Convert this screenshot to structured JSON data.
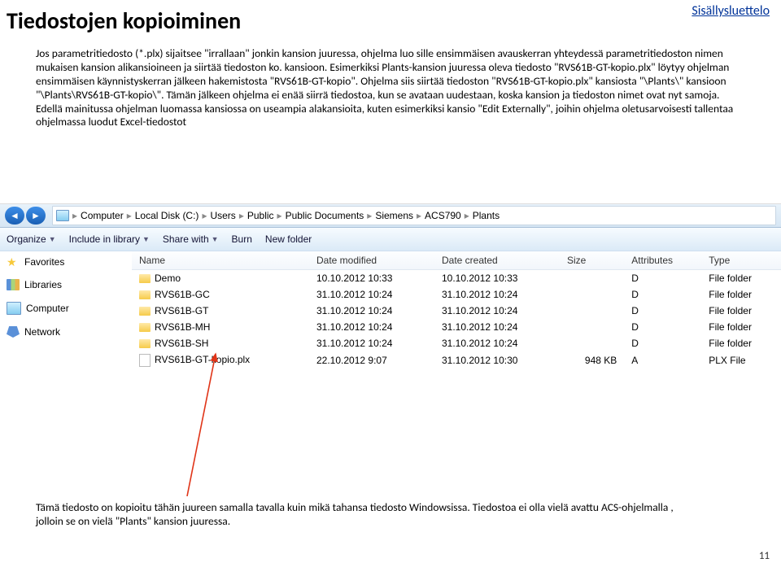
{
  "title": "Tiedostojen kopioiminen",
  "toc_link": "Sisällysluettelo",
  "body": "Jos parametritiedosto (*.plx) sijaitsee \"irrallaan\" jonkin kansion juuressa, ohjelma luo sille ensimmäisen avauskerran yhteydessä parametritiedoston nimen mukaisen kansion alikansioineen ja siirtää tiedoston ko. kansioon. Esimerkiksi Plants-kansion juuressa oleva tiedosto \"RVS61B-GT-kopio.plx\" löytyy ohjelman ensimmäisen käynnistyskerran jälkeen hakemistosta \"RVS61B-GT-kopio\". Ohjelma siis siirtää tiedoston \"RVS61B-GT-kopio.plx\" kansiosta \"\\Plants\\\" kansioon \"\\Plants\\RVS61B-GT-kopio\\\". Tämän jälkeen ohjelma ei enää siirrä tiedostoa, kun se avataan uudestaan, koska kansion ja tiedoston nimet ovat nyt samoja. Edellä mainitussa ohjelman luomassa kansiossa on useampia alakansioita, kuten esimerkiksi kansio \"Edit Externally\", joihin ohjelma oletusarvoisesti tallentaa ohjelmassa luodut Excel-tiedostot",
  "explorer": {
    "breadcrumb": [
      "Computer",
      "Local Disk (C:)",
      "Users",
      "Public",
      "Public Documents",
      "Siemens",
      "ACS790",
      "Plants"
    ],
    "toolbar": {
      "organize": "Organize",
      "include": "Include in library",
      "share": "Share with",
      "burn": "Burn",
      "newfolder": "New folder"
    },
    "nav": {
      "favorites": "Favorites",
      "libraries": "Libraries",
      "computer": "Computer",
      "network": "Network"
    },
    "columns": {
      "name": "Name",
      "modified": "Date modified",
      "created": "Date created",
      "size": "Size",
      "attributes": "Attributes",
      "type": "Type"
    },
    "rows": [
      {
        "icon": "folder",
        "name": "Demo",
        "modified": "10.10.2012 10:33",
        "created": "10.10.2012 10:33",
        "size": "",
        "attr": "D",
        "type": "File folder"
      },
      {
        "icon": "folder",
        "name": "RVS61B-GC",
        "modified": "31.10.2012 10:24",
        "created": "31.10.2012 10:24",
        "size": "",
        "attr": "D",
        "type": "File folder"
      },
      {
        "icon": "folder",
        "name": "RVS61B-GT",
        "modified": "31.10.2012 10:24",
        "created": "31.10.2012 10:24",
        "size": "",
        "attr": "D",
        "type": "File folder"
      },
      {
        "icon": "folder",
        "name": "RVS61B-MH",
        "modified": "31.10.2012 10:24",
        "created": "31.10.2012 10:24",
        "size": "",
        "attr": "D",
        "type": "File folder"
      },
      {
        "icon": "folder",
        "name": "RVS61B-SH",
        "modified": "31.10.2012 10:24",
        "created": "31.10.2012 10:24",
        "size": "",
        "attr": "D",
        "type": "File folder"
      },
      {
        "icon": "file",
        "name": "RVS61B-GT-kopio.plx",
        "modified": "22.10.2012 9:07",
        "created": "31.10.2012 10:30",
        "size": "948 KB",
        "attr": "A",
        "type": "PLX File"
      }
    ]
  },
  "caption": "Tämä tiedosto on kopioitu tähän juureen samalla tavalla kuin mikä tahansa tiedosto Windowsissa. Tiedostoa ei olla vielä avattu ACS-ohjelmalla , jolloin se on vielä \"Plants\" kansion juuressa.",
  "page_number": "11"
}
